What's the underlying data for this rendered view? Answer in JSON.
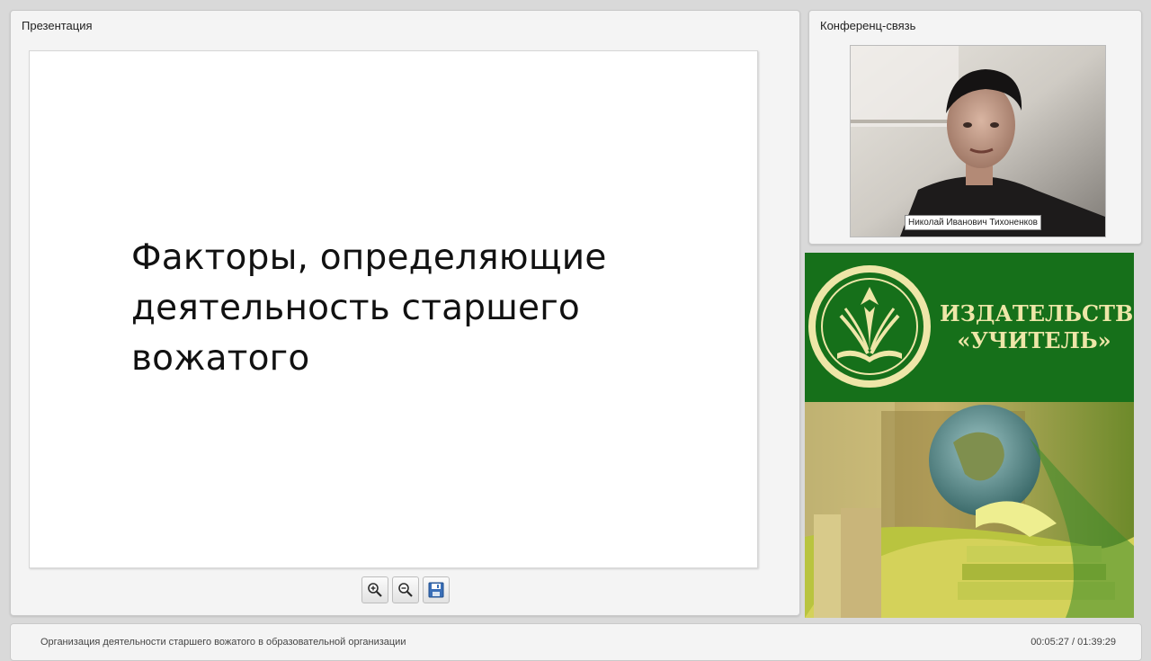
{
  "presentation": {
    "title": "Презентация",
    "slide_text": "Факторы, определяющие деятельность старшего вожатого"
  },
  "toolbar": {
    "zoom_in_icon": "zoom-in-icon",
    "zoom_out_icon": "zoom-out-icon",
    "save_icon": "floppy-disk-icon"
  },
  "conference": {
    "title": "Конференц-связь",
    "speaker_name": "Николай Иванович Тихоненков"
  },
  "banner": {
    "line1": "ИЗДАТЕЛЬСТВО",
    "line2": "«УЧИТЕЛЬ»",
    "logo_color": "#eee6a8",
    "background_color": "#16701a"
  },
  "footer": {
    "course_title": "Организация деятельности старшего вожатого в образовательной организации",
    "time": "00:05:27 / 01:39:29"
  }
}
